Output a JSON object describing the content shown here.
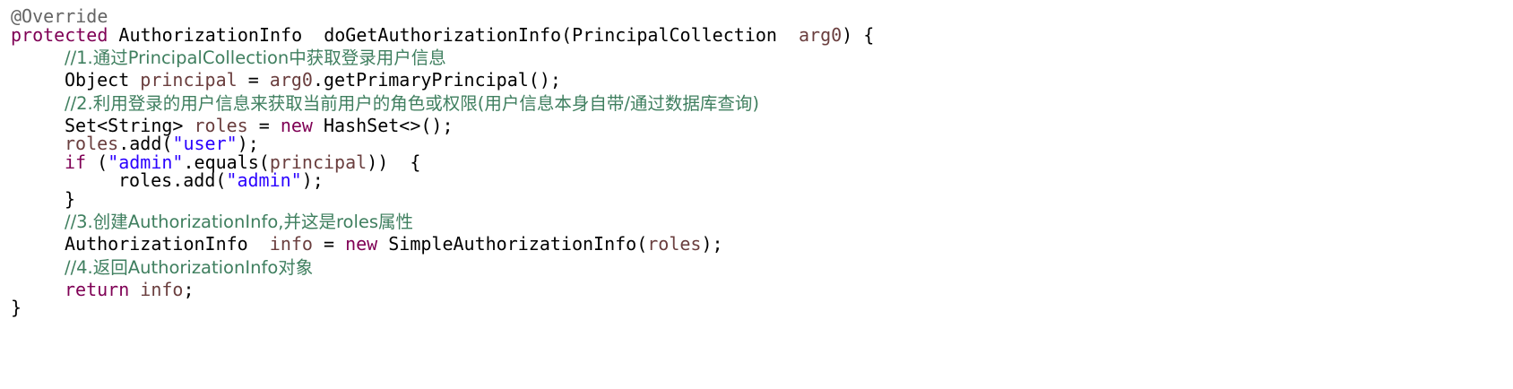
{
  "code": {
    "l1": {
      "annotation": "@Override"
    },
    "l2": {
      "kw_protected": "protected",
      "sig1": " AuthorizationInfo  doGetAuthorizationInfo(PrincipalCollection  ",
      "param": "arg0",
      "sig2": ") {"
    },
    "l3": {
      "comment": "//1.通过PrincipalCollection中获取登录用户信息"
    },
    "l4": {
      "t1": "Object ",
      "v1": "principal",
      "t2": " = ",
      "v2": "arg0",
      "t3": ".getPrimaryPrincipal();"
    },
    "l5": {
      "comment": "//2.利用登录的用户信息来获取当前用户的角色或权限(用户信息本身自带/通过数据库查询)"
    },
    "l6": {
      "t1": "Set<String> ",
      "v1": "roles",
      "t2": " = ",
      "kw": "new",
      "t3": " HashSet<>();"
    },
    "l7": {
      "v1": "roles",
      "t1": ".add(",
      "s1": "\"user\"",
      "t2": ");"
    },
    "l8": {
      "kw": "if",
      "t1": " (",
      "s1": "\"admin\"",
      "t2": ".equals(",
      "v1": "principal",
      "t3": "))  {"
    },
    "l9": {
      "t1": "roles.add(",
      "s1": "\"admin\"",
      "t2": ");"
    },
    "l10": {
      "t1": "}"
    },
    "l11": {
      "comment": "//3.创建AuthorizationInfo,并这是roles属性"
    },
    "l12": {
      "t1": "AuthorizationInfo  ",
      "v1": "info",
      "t2": " = ",
      "kw": "new",
      "t3": " SimpleAuthorizationInfo(",
      "v2": "roles",
      "t4": ");"
    },
    "l13": {
      "comment": "//4.返回AuthorizationInfo对象"
    },
    "l14": {
      "kw": "return",
      "t1": " ",
      "v1": "info",
      "t2": ";"
    },
    "l15": {
      "t1": "}"
    }
  },
  "colors": {
    "keyword": "#7f0055",
    "variable": "#6a3e3e",
    "string": "#2a00ff",
    "comment": "#3f7f5f",
    "annotation": "#646464"
  }
}
